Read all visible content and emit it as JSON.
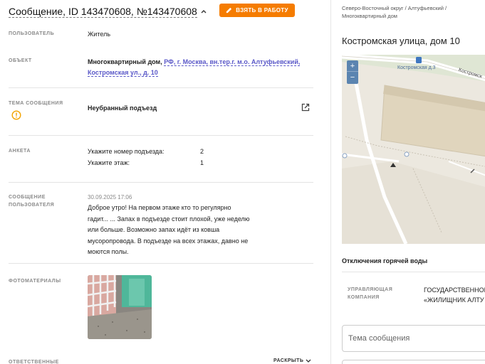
{
  "header": {
    "title": "Сообщение, ID 143470608, №143470608",
    "take_button": "ВЗЯТЬ В РАБОТУ"
  },
  "fields": {
    "user_label": "ПОЛЬЗОВАТЕЛЬ",
    "user_value": "Житель",
    "object_label": "ОБЪЕКТ",
    "object_type": "Многоквартирный дом,",
    "object_link_line1": "РФ, г. Москва, вн.тер.г. м.о. Алтуфьевский,",
    "object_link_line2": "Костромская ул., д. 10",
    "topic_label": "ТЕМА СООБЩЕНИЯ",
    "topic_value": "Неубранный подъезд",
    "survey_label": "АНКЕТА",
    "survey_rows": [
      {
        "q": "Укажите номер подъезда:",
        "a": "2"
      },
      {
        "q": "Укажите этаж:",
        "a": "1"
      }
    ],
    "message_label_line1": "СООБЩЕНИЕ",
    "message_label_line2": "ПОЛЬЗОВАТЕЛЯ",
    "message_date": "30.09.2025 17:06",
    "message_lines": [
      "Доброе утро! На первом этаже кто то регулярно",
      "гадит... ... Запах в подъезде стоит плохой, уже неделю",
      "или больше. Возможно запах идёт из ковша",
      "мусоропровода. В подъезде на всех этажах, давно не",
      "моются полы."
    ],
    "photos_label": "ФОТОМАТЕРИАЛЫ",
    "responsible_label": "ОТВЕТСТВЕННЫЕ",
    "expand_label": "РАСКРЫТЬ"
  },
  "right": {
    "breadcrumb_line1": "Северо-Восточный округ / Алтуфьевский /",
    "breadcrumb_line2": "Многоквартирный дом",
    "address": "Костромская улица, дом 10",
    "map_label_house": "Костромская д.3",
    "map_label_street": "Костромск",
    "zoom_in": "+",
    "zoom_out": "−",
    "hot_water": "Отключения горячей воды",
    "mc_label": "УПРАВЛЯЮЩАЯ КОМПАНИЯ",
    "mc_value_line1": "ГОСУДАРСТВЕННОЕ",
    "mc_value_line2": "«ЖИЛИЩНИК АЛТУ",
    "topic_input_placeholder": "Тема сообщения"
  },
  "colors": {
    "accent": "#f57c00",
    "link": "#5a58c8",
    "map_bg": "#ece8df",
    "zoom_bg": "#5b84b0"
  }
}
